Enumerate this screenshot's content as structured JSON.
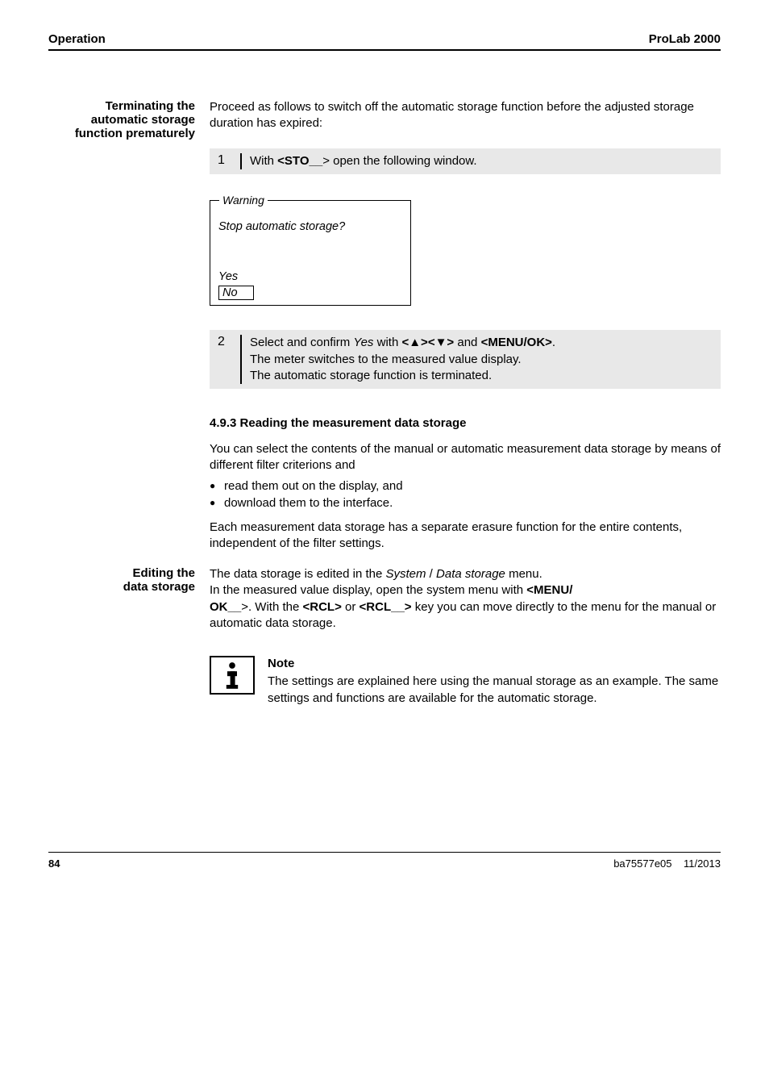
{
  "header": {
    "left": "Operation",
    "right": "ProLab 2000"
  },
  "sect1": {
    "side_heading": "Terminating the\nautomatic storage\nfunction prematurely",
    "intro": "Proceed as follows to switch off the automatic storage function before the adjusted storage duration has expired:",
    "step1_num": "1",
    "step1_pre": "With ",
    "step1_key": "<STO__",
    "step1_post": "> open the following window.",
    "warning_label": "Warning",
    "warning_question": "Stop automatic storage?",
    "warning_yes": "Yes",
    "warning_no": "No",
    "step2_num": "2",
    "step2_a_pre": "Select and confirm ",
    "step2_a_yes": "Yes",
    "step2_a_mid": " with ",
    "step2_a_key1": "<▲><▼>",
    "step2_a_and": " and ",
    "step2_a_key2": "<MENU/OK>",
    "step2_a_end": ".",
    "step2_b": "The meter switches to the measured value display.",
    "step2_c": "The automatic storage function is terminated."
  },
  "sect2": {
    "heading": "4.9.3   Reading the measurement data storage",
    "p1": "You can select the contents of the manual or automatic measurement data storage by means of different filter criterions and",
    "b1": "read them out on the display, and",
    "b2": "download them to the interface.",
    "p2": "Each measurement data storage has a separate erasure function for the entire contents, independent of the filter settings."
  },
  "sect3": {
    "side_heading": "Editing the\ndata storage",
    "line1_pre": "The data storage is edited in the ",
    "line1_sys": "System",
    "line1_sep": " / ",
    "line1_ds": "Data storage",
    "line1_post": " menu.",
    "line2_pre": "In the measured value display, open the system menu with ",
    "line2_menu": "<MENU/",
    "line3_ok": "OK__",
    "line3_a": ">. With the ",
    "line3_rcl1": "<RCL>",
    "line3_or": " or ",
    "line3_rcl2": "<RCL__>",
    "line3_b": " key you can move directly to the menu for the manual or automatic data storage."
  },
  "note": {
    "icon_name": "info-icon",
    "heading": "Note",
    "body": "The settings are explained here using the manual storage as an example. The same settings and functions are available for the automatic storage."
  },
  "footer": {
    "page": "84",
    "doc": "ba75577e05",
    "date": "11/2013"
  }
}
